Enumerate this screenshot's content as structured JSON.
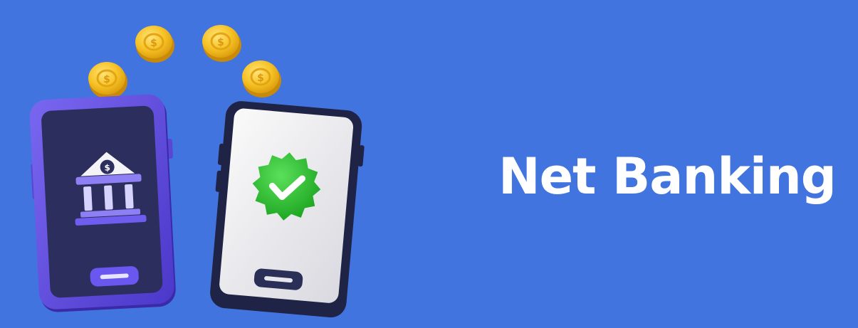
{
  "banner": {
    "title": "Net Banking",
    "background_color": "#4274e0",
    "icons": {
      "coins": "dollar-coin-icon",
      "left_phone": "bank-building-icon",
      "right_phone": "verified-check-badge-icon"
    }
  }
}
